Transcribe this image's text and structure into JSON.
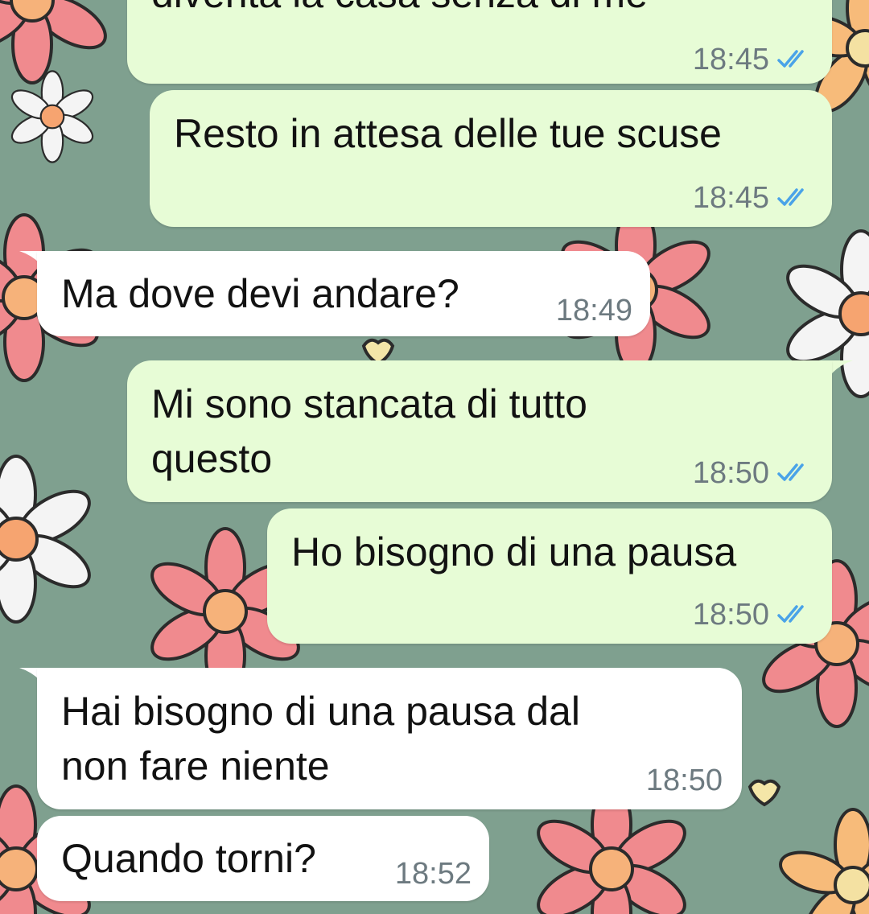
{
  "theme": {
    "outgoing_bg": "#e7fcd6",
    "incoming_bg": "#ffffff",
    "read_tick_color": "#4aa3e8",
    "wallpaper_bg": "#7fa08f"
  },
  "messages": [
    {
      "direction": "outgoing",
      "text": "diventa la casa senza di me",
      "time": "18:45",
      "status": "read"
    },
    {
      "direction": "outgoing",
      "text": "Resto in attesa delle tue scuse",
      "time": "18:45",
      "status": "read"
    },
    {
      "direction": "incoming",
      "text": "Ma dove devi andare?",
      "time": "18:49"
    },
    {
      "direction": "outgoing",
      "lines": [
        "Mi sono stancata di tutto",
        "questo"
      ],
      "time": "18:50",
      "status": "read"
    },
    {
      "direction": "outgoing",
      "text": "Ho bisogno di una pausa",
      "time": "18:50",
      "status": "read"
    },
    {
      "direction": "incoming",
      "lines": [
        "Hai bisogno di una pausa dal",
        "non fare niente"
      ],
      "time": "18:50"
    },
    {
      "direction": "incoming",
      "text": "Quando torni?",
      "time": "18:52"
    }
  ]
}
